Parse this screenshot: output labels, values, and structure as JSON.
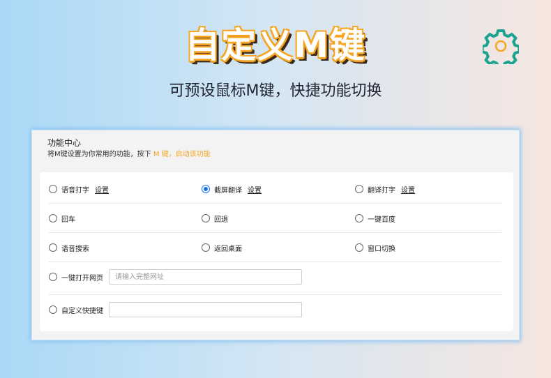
{
  "hero": {
    "title": "自定义M键",
    "subtitle": "可预设鼠标M键，快捷功能切换"
  },
  "colors": {
    "accent": "#1a73e8",
    "highlight": "#f5a623",
    "gear": "#1aa390"
  },
  "icons": {
    "gear": "gear-icon"
  },
  "panel": {
    "title": "功能中心",
    "desc_prefix": "将M键设置为你常用的功能，按下",
    "desc_key": "M 键，启动该功能"
  },
  "options": {
    "voice_typing": {
      "label": "语音打字",
      "link": "设置",
      "selected": false
    },
    "screenshot_translate": {
      "label": "截屏翻译",
      "link": "设置",
      "selected": true
    },
    "translate_typing": {
      "label": "翻译打字",
      "link": "设置",
      "selected": false
    },
    "enter": {
      "label": "回车",
      "selected": false
    },
    "backspace": {
      "label": "回退",
      "selected": false
    },
    "baidu": {
      "label": "一键百度",
      "selected": false
    },
    "voice_search": {
      "label": "语音搜索",
      "selected": false
    },
    "desktop": {
      "label": "返回桌面",
      "selected": false
    },
    "window_switch": {
      "label": "窗口切换",
      "selected": false
    },
    "open_web": {
      "label": "一键打开网页",
      "placeholder": "请输入完整网址",
      "value": "",
      "selected": false
    },
    "custom_hotkey": {
      "label": "自定义快捷键",
      "value": "",
      "selected": false
    }
  }
}
